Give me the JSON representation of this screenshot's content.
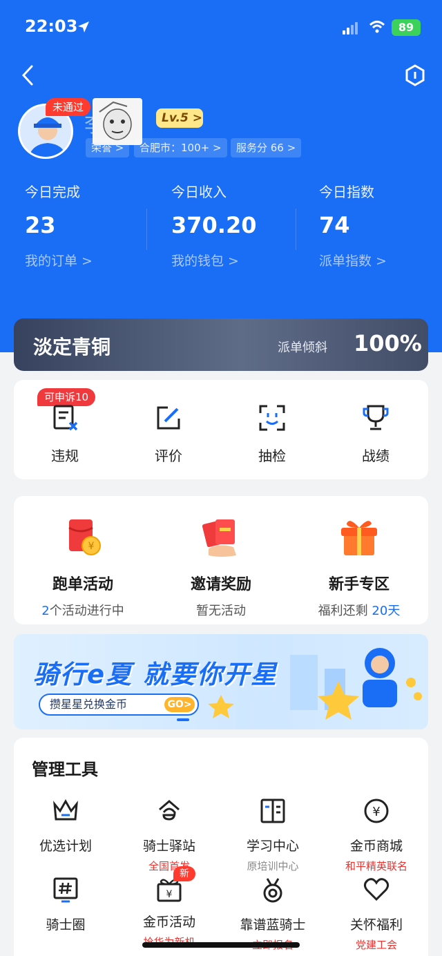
{
  "colors": {
    "primary": "#1a6ef5",
    "red": "#e8332f",
    "rank_bg": "#37435e",
    "battery": "#3bd15a"
  },
  "status_bar": {
    "time": "22:03",
    "battery": "89"
  },
  "profile": {
    "status_badge": "未通过",
    "level": "Lv.5 >",
    "chips": [
      "荣誉 >",
      "合肥市：100+ >",
      "服务分 66 >"
    ]
  },
  "stats": [
    {
      "label": "今日完成",
      "value": "23",
      "link": "我的订单 >"
    },
    {
      "label": "今日收入",
      "value": "370.20",
      "link": "我的钱包 >"
    },
    {
      "label": "今日指数",
      "value": "74",
      "link": "派单指数 >"
    }
  ],
  "rank": {
    "title": "淡定青铜",
    "sub_label": "派单倾斜",
    "percent": "100%"
  },
  "quick_actions": {
    "appeal_badge": "可申诉10",
    "items": [
      "违规",
      "评价",
      "抽检",
      "战绩"
    ]
  },
  "activities": [
    {
      "title": "跑单活动",
      "count": "2",
      "sub": "个活动进行中"
    },
    {
      "title": "邀请奖励",
      "sub": "暂无活动"
    },
    {
      "title": "新手专区",
      "sub_pre": "福利还剩",
      "count": "20",
      "sub_post": "天"
    }
  ],
  "banner": {
    "title": "骑行e夏 就要你开星",
    "pill": "攒星星兑换金币",
    "go": "GO>"
  },
  "tools": {
    "title": "管理工具",
    "items": [
      {
        "label": "优选计划",
        "sub": ""
      },
      {
        "label": "骑士驿站",
        "sub": "全国首发"
      },
      {
        "label": "学习中心",
        "sub": "原培训中心"
      },
      {
        "label": "金币商城",
        "sub": "和平精英联名"
      },
      {
        "label": "骑士圈",
        "sub": ""
      },
      {
        "label": "金币活动",
        "sub": "抢华为新机",
        "badge": "新"
      },
      {
        "label": "靠谱蓝骑士",
        "sub": "立即报名"
      },
      {
        "label": "关怀福利",
        "sub": "党建工会"
      }
    ]
  }
}
